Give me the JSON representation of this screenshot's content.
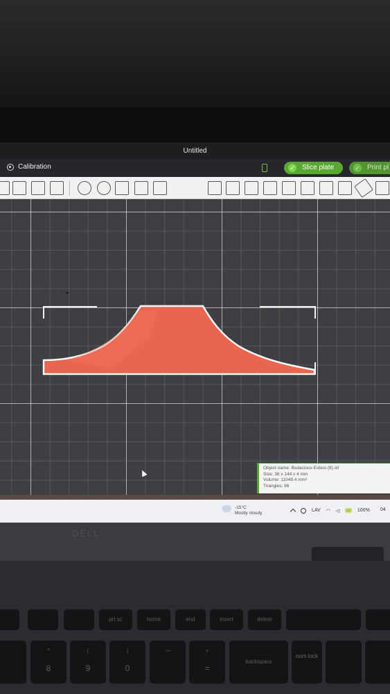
{
  "window": {
    "title": "Untitled"
  },
  "topbar": {
    "calibration_label": "Calibration",
    "slice_label": "Slice plate",
    "print_label": "Print pl",
    "accent_color": "#5aa832"
  },
  "toolbar": {
    "left_icons": [
      "add-icon",
      "add-plate-icon",
      "arrange-icon",
      "layers-icon",
      "move-icon",
      "rotate-icon",
      "scale-icon",
      "place-on-face-icon",
      "cut-icon"
    ],
    "right_icons": [
      "paint-icon",
      "text-icon",
      "support-icon",
      "seam-icon",
      "cube-icon",
      "assembly-icon",
      "variable-layer-icon",
      "measure-icon"
    ]
  },
  "model": {
    "color": "#e8654f"
  },
  "object_info": {
    "name": "Object name: Bodacious Esboo (8).stl",
    "size": "Size: 36 x 144 x 4 mm",
    "volume": "Volume: 11049.4 mm³",
    "triangles": "Triangles: 96"
  },
  "taskbar": {
    "temperature": "-15°C",
    "condition": "Mostly cloudy",
    "language": "LAV",
    "battery": "100%",
    "clock": "04"
  },
  "laptop": {
    "brand": "DELL",
    "keys_row1": [
      "prt sc",
      "home",
      "end",
      "insert",
      "delete"
    ],
    "keys_row2": [
      "*",
      "(",
      ")",
      "—",
      "+",
      "backspace",
      "num lock"
    ],
    "keys_row2_sub": [
      "8",
      "9",
      "0",
      "",
      "="
    ]
  }
}
